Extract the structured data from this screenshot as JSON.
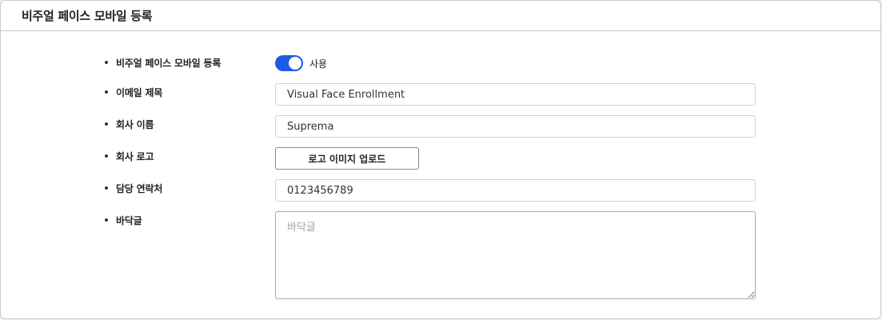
{
  "panel": {
    "title": "비주얼 페이스 모바일 등록"
  },
  "form": {
    "enroll": {
      "label": "비주얼 페이스 모바일 등록",
      "toggle_on": true,
      "toggle_text": "사용"
    },
    "email_subject": {
      "label": "이메일 제목",
      "value": "Visual Face Enrollment"
    },
    "company_name": {
      "label": "회사 이름",
      "value": "Suprema"
    },
    "company_logo": {
      "label": "회사 로고",
      "button_label": "로고 이미지 업로드"
    },
    "contact": {
      "label": "담당 연락처",
      "value": "0123456789"
    },
    "footer": {
      "label": "바닥글",
      "placeholder": "바닥글",
      "value": ""
    }
  },
  "colors": {
    "toggle_accent": "#1e5be6",
    "border": "#c9c9c9"
  }
}
